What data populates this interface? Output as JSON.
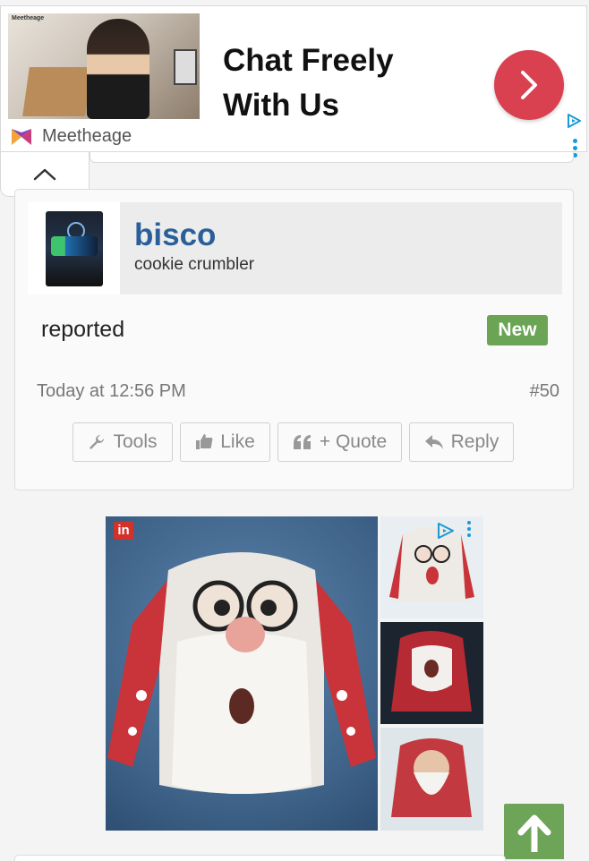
{
  "top_ad": {
    "photo_brand": "Meetheage",
    "headline_line1": "Chat Freely",
    "headline_line2": "With Us",
    "advertiser": "Meetheage",
    "cta_icon": "chevron-right-icon",
    "accent_color": "#d94050"
  },
  "post": {
    "username": "bisco",
    "user_title": "cookie crumbler",
    "message": "reported",
    "badge": "New",
    "date": "Today at 12:56 PM",
    "post_number": "#50",
    "actions": {
      "tools": "Tools",
      "like": "Like",
      "quote": "+ Quote",
      "reply": "Reply"
    }
  },
  "product_ad": {
    "badge": "in",
    "images": [
      "santa-face-sweater-main",
      "santa-sweater-thumb-1",
      "santa-sweater-thumb-2",
      "santa-sweater-thumb-3"
    ]
  },
  "colors": {
    "username": "#2a5f9a",
    "badge_green": "#6aa454",
    "scroll_top_green": "#6ea457"
  }
}
